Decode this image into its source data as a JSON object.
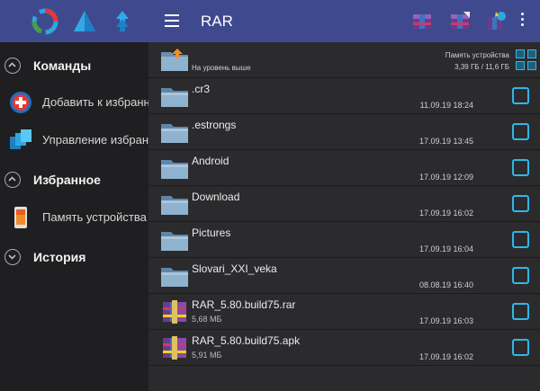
{
  "drawer": {
    "header_icons": [
      "sync-icon",
      "triangle-icon",
      "arrows-up-icon"
    ],
    "sections": {
      "commands": "Команды",
      "favorites": "Избранное",
      "history": "История"
    },
    "items": {
      "add_favorite": "Добавить к избранному",
      "manage_favorites": "Управление избранным",
      "device_memory": "Память устройства"
    }
  },
  "toolbar": {
    "title": "RAR",
    "buttons": [
      "archive-icon",
      "extract-icon",
      "wizard-icon",
      "more-vert-icon"
    ]
  },
  "list": {
    "up": {
      "label": "На уровень выше",
      "storage_label": "Память устройства",
      "storage_value": "3,39 ГБ / 11,6 ГБ"
    },
    "items": [
      {
        "type": "folder",
        "name": ".cr3",
        "date": "11.09.19 18:24"
      },
      {
        "type": "folder",
        "name": ".estrongs",
        "date": "17.09.19 13:45"
      },
      {
        "type": "folder",
        "name": "Android",
        "date": "17.09.19 12:09"
      },
      {
        "type": "folder",
        "name": "Download",
        "date": "17.09.19 16:02"
      },
      {
        "type": "folder",
        "name": "Pictures",
        "date": "17.09.19 16:04"
      },
      {
        "type": "folder",
        "name": "Slovari_XXI_veka",
        "date": "08.08.19 16:40"
      },
      {
        "type": "archive",
        "name": "RAR_5.80.build75.rar",
        "size": "5,68 МБ",
        "date": "17.09.19 16:03"
      },
      {
        "type": "archive",
        "name": "RAR_5.80.build75.apk",
        "size": "5,91 МБ",
        "date": "17.09.19 16:02"
      }
    ]
  },
  "colors": {
    "toolbar": "#3f4a8e",
    "drawer_bg": "#1f1f21",
    "list_bg": "#2b2b2e",
    "checkbox": "#2fb7e8"
  }
}
